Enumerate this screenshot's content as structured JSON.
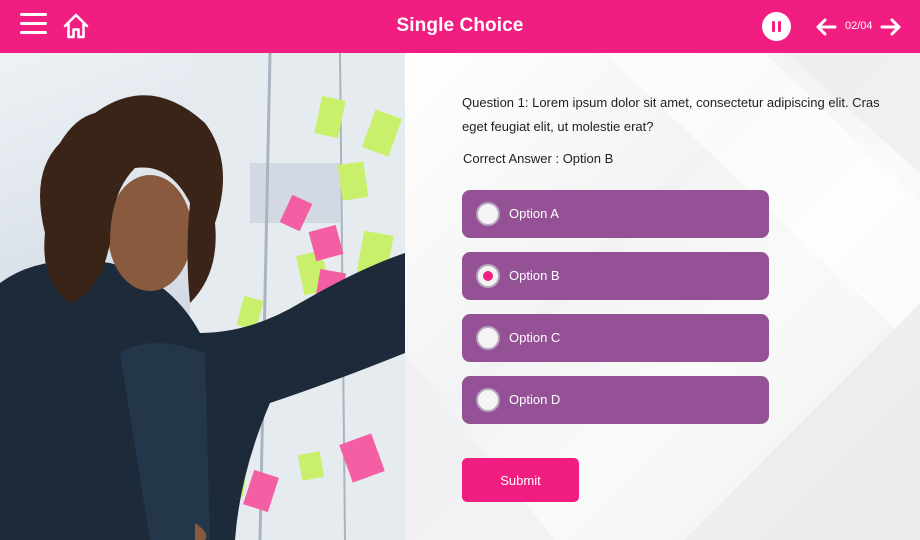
{
  "header": {
    "title": "Single Choice",
    "page_counter": "02/04",
    "icons": {
      "menu": "hamburger-menu-icon",
      "home": "home-icon",
      "pause": "pause-icon",
      "prev": "arrow-left-icon",
      "next": "arrow-right-icon"
    }
  },
  "colors": {
    "accent": "#f21d80",
    "option_bg": "#955196",
    "selected_dot": "#f21d80"
  },
  "quiz": {
    "question": "Question 1: Lorem ipsum dolor sit amet, consectetur adipiscing elit. Cras eget feugiat elit, ut molestie erat?",
    "correct_answer": "Correct Answer : Option B",
    "options": [
      {
        "label": "Option A",
        "selected": false
      },
      {
        "label": "Option B",
        "selected": true
      },
      {
        "label": "Option C",
        "selected": false
      },
      {
        "label": "Option D",
        "selected": false
      }
    ],
    "submit_label": "Submit"
  }
}
